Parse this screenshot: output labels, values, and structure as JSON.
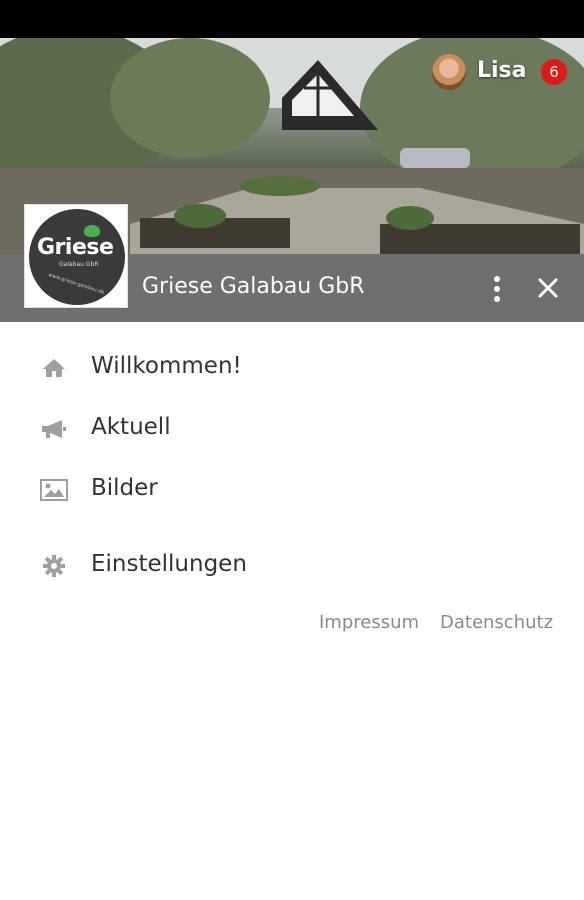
{
  "header": {
    "user_name": "Lisa",
    "notification_count": "6",
    "app_title": "Griese Galabau GbR"
  },
  "logo": {
    "brand": "Griese",
    "subtitle": "Galabau GbR",
    "url": "www.griese-galabau.de"
  },
  "menu": {
    "items": [
      {
        "label": "Willkommen!",
        "icon": "home-icon"
      },
      {
        "label": "Aktuell",
        "icon": "megaphone-icon"
      },
      {
        "label": "Bilder",
        "icon": "image-icon"
      },
      {
        "label": "Einstellungen",
        "icon": "gear-icon"
      }
    ]
  },
  "footer": {
    "impressum": "Impressum",
    "datenschutz": "Datenschutz"
  },
  "colors": {
    "title_bar": "#6f6f6f",
    "badge": "#e01818",
    "icon_gray": "#9e9e9e",
    "text": "#333333",
    "link": "#8a8a8a"
  }
}
